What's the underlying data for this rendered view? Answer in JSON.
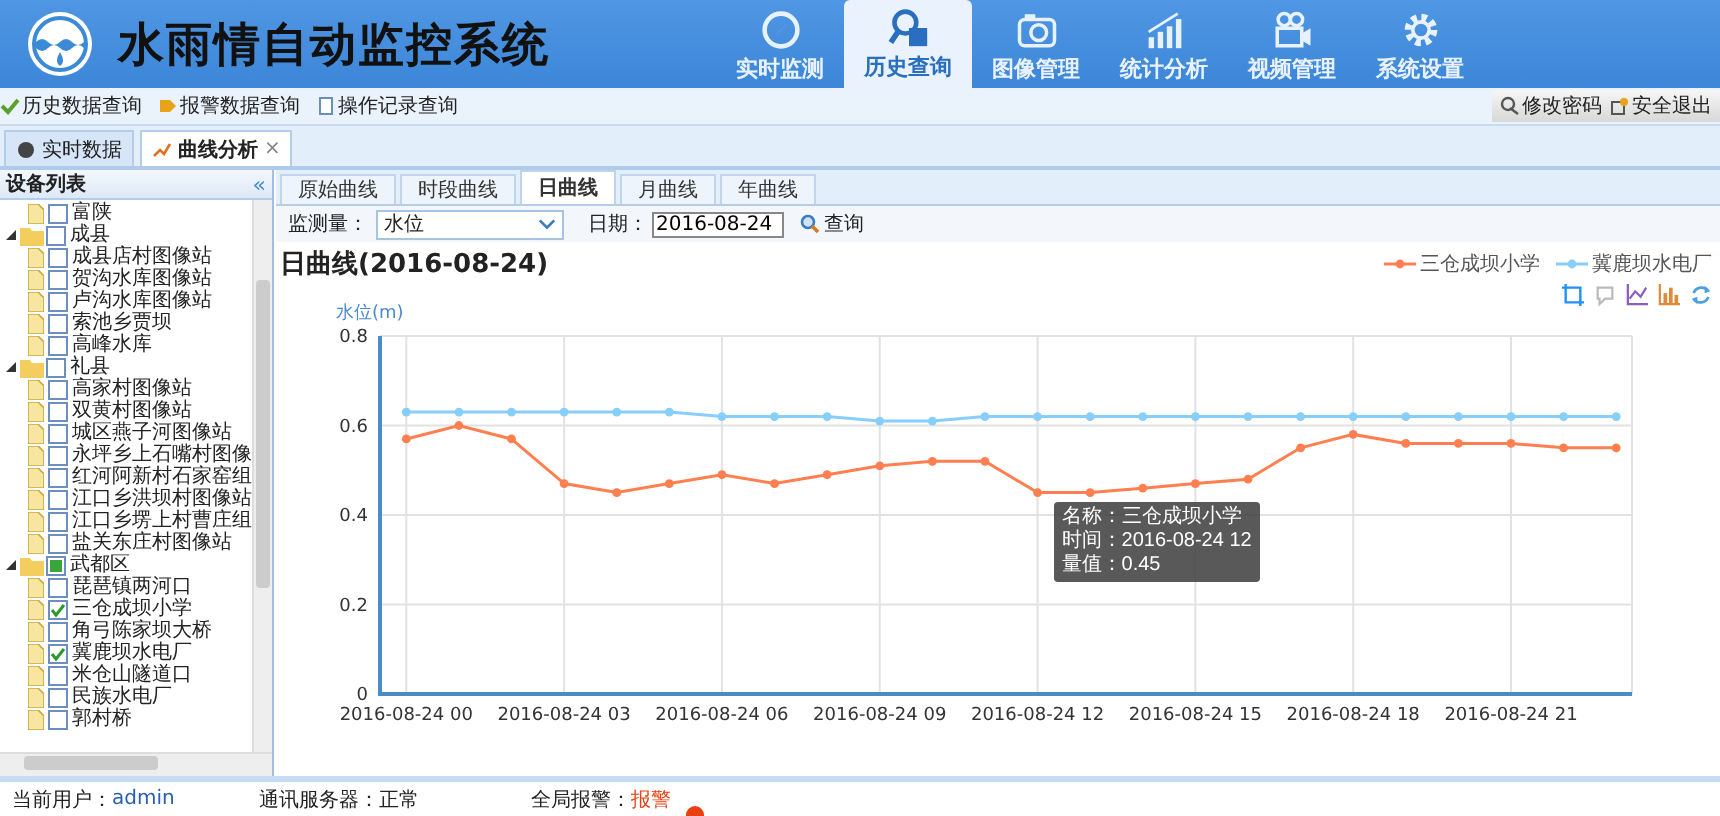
{
  "header": {
    "title": "水雨情自动监控系统",
    "nav": [
      {
        "label": "实时监测",
        "selected": false
      },
      {
        "label": "历史查询",
        "selected": true
      },
      {
        "label": "图像管理",
        "selected": false
      },
      {
        "label": "统计分析",
        "selected": false
      },
      {
        "label": "视频管理",
        "selected": false
      },
      {
        "label": "系统设置",
        "selected": false
      }
    ]
  },
  "toolbar": {
    "links": [
      "历史数据查询",
      "报警数据查询",
      "操作记录查询"
    ],
    "account": [
      "修改密码",
      "安全退出"
    ]
  },
  "page_tabs": [
    {
      "label": "实时数据",
      "selected": false
    },
    {
      "label": "曲线分析",
      "selected": true,
      "close": "×"
    }
  ],
  "sidebar": {
    "title": "设备列表",
    "collapse": "«",
    "tree": [
      {
        "label": "富陕",
        "checked": false
      },
      {
        "label": "成县",
        "checked": false,
        "partial": false,
        "expanded": true,
        "children": [
          {
            "label": "成县店村图像站",
            "checked": false
          },
          {
            "label": "贺沟水库图像站",
            "checked": false
          },
          {
            "label": "卢沟水库图像站",
            "checked": false
          },
          {
            "label": "索池乡贾坝",
            "checked": false
          },
          {
            "label": "高峰水库",
            "checked": false
          }
        ]
      },
      {
        "label": "礼县",
        "checked": false,
        "partial": false,
        "expanded": true,
        "children": [
          {
            "label": "高家村图像站",
            "checked": false
          },
          {
            "label": "双黄村图像站",
            "checked": false
          },
          {
            "label": "城区燕子河图像站",
            "checked": false
          },
          {
            "label": "永坪乡上石嘴村图像",
            "checked": false
          },
          {
            "label": "红河阿新村石家窑组",
            "checked": false
          },
          {
            "label": "江口乡洪坝村图像站",
            "checked": false
          },
          {
            "label": "江口乡塄上村曹庄组",
            "checked": false
          },
          {
            "label": "盐关东庄村图像站",
            "checked": false
          }
        ]
      },
      {
        "label": "武都区",
        "checked": false,
        "partial": true,
        "expanded": true,
        "children": [
          {
            "label": "琵琶镇两河口",
            "checked": false
          },
          {
            "label": "三仓成坝小学",
            "checked": true
          },
          {
            "label": "角弓陈家坝大桥",
            "checked": false
          },
          {
            "label": "冀鹿坝水电厂",
            "checked": true
          },
          {
            "label": "米仓山隧道口",
            "checked": false
          },
          {
            "label": "民族水电厂",
            "checked": false
          },
          {
            "label": "郭村桥",
            "checked": false
          }
        ]
      }
    ]
  },
  "curve_tabs": [
    {
      "label": "原始曲线",
      "selected": false
    },
    {
      "label": "时段曲线",
      "selected": false
    },
    {
      "label": "日曲线",
      "selected": true
    },
    {
      "label": "月曲线",
      "selected": false
    },
    {
      "label": "年曲线",
      "selected": false
    }
  ],
  "query": {
    "measure_label": "监测量：",
    "measure": "水位",
    "date_label": "日期：",
    "date": "2016-08-24",
    "search": "查询"
  },
  "chart": {
    "tooltip": [
      "名称：三仓成坝小学",
      "时间：2016-08-24 12",
      "量值：0.45"
    ],
    "chart_data": {
      "type": "line",
      "title": "日曲线(2016-08-24)",
      "ylabel": "水位(m)",
      "categories": [
        "2016-08-24 00",
        null,
        null,
        "2016-08-24 03",
        null,
        null,
        "2016-08-24 06",
        null,
        null,
        "2016-08-24 09",
        null,
        null,
        "2016-08-24 12",
        null,
        null,
        "2016-08-24 15",
        null,
        null,
        "2016-08-24 18",
        null,
        null,
        "2016-08-24 21",
        null,
        null
      ],
      "ylim": [
        0,
        0.8
      ],
      "grid": true,
      "legend": "top-right",
      "yticks": [
        0,
        0.2,
        0.4,
        0.6,
        0.8
      ],
      "series": [
        {
          "name": "三仓成坝小学",
          "color": "#ff7f50",
          "marker": "circle",
          "values": [
            0.57,
            0.6,
            0.57,
            0.47,
            0.45,
            0.47,
            0.49,
            0.47,
            0.49,
            0.51,
            0.52,
            0.52,
            0.45,
            0.45,
            0.46,
            0.47,
            0.48,
            0.55,
            0.58,
            0.56,
            0.56,
            0.56,
            0.55,
            0.55
          ]
        },
        {
          "name": "冀鹿坝水电厂",
          "color": "#87cefa",
          "marker": "circle",
          "values": [
            0.63,
            0.63,
            0.63,
            0.63,
            0.63,
            0.63,
            0.62,
            0.62,
            0.62,
            0.61,
            0.61,
            0.62,
            0.62,
            0.62,
            0.62,
            0.62,
            0.62,
            0.62,
            0.62,
            0.62,
            0.62,
            0.62,
            0.62,
            0.62
          ]
        }
      ]
    }
  },
  "status_bar": {
    "user_label": "当前用户：",
    "user": "admin",
    "server_label": "通讯服务器：",
    "server": "正常",
    "alarm_label": "全局报警：",
    "alarm": "报警"
  }
}
